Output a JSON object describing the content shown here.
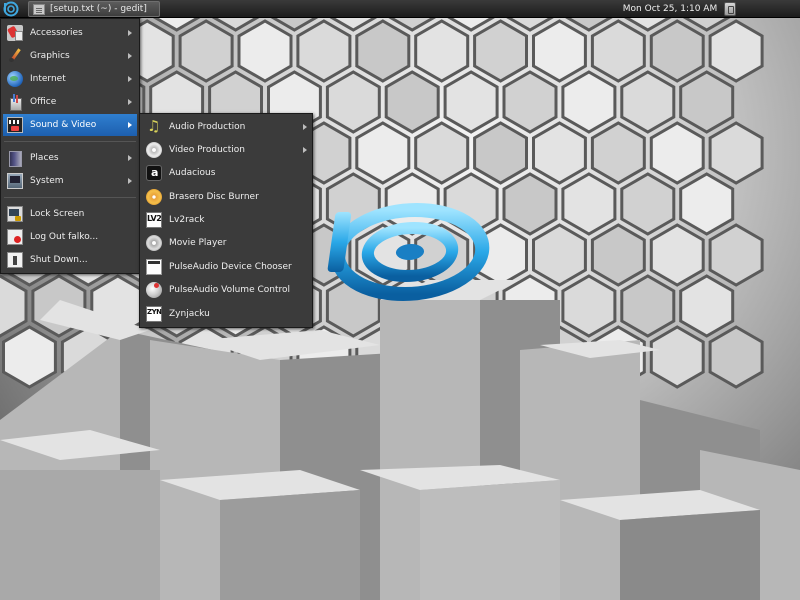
{
  "panel": {
    "menu_button_icon": "distro-logo-icon",
    "window_button": {
      "title": "[setup.txt (~) - gedit]",
      "icon": "text-editor-icon"
    },
    "clock": "Mon Oct 25,  1:10 AM",
    "tray_icon": "system-tray-icon"
  },
  "main_menu": {
    "items": [
      {
        "label": "Accessories",
        "icon": "accessories-icon",
        "has_submenu": true
      },
      {
        "label": "Graphics",
        "icon": "graphics-icon",
        "has_submenu": true
      },
      {
        "label": "Internet",
        "icon": "internet-globe-icon",
        "has_submenu": true
      },
      {
        "label": "Office",
        "icon": "office-icon",
        "has_submenu": true
      },
      {
        "label": "Sound & Video",
        "icon": "sound-video-icon",
        "has_submenu": true,
        "active": true
      },
      {
        "label": "Places",
        "icon": "places-icon",
        "has_submenu": true
      },
      {
        "label": "System",
        "icon": "system-icon",
        "has_submenu": true
      },
      {
        "label": "Lock Screen",
        "icon": "lock-screen-icon",
        "has_submenu": false
      },
      {
        "label": "Log Out falko...",
        "icon": "log-out-icon",
        "has_submenu": false
      },
      {
        "label": "Shut Down...",
        "icon": "shut-down-icon",
        "has_submenu": false
      }
    ]
  },
  "sound_video_menu": {
    "items": [
      {
        "label": "Audio Production",
        "icon": "music-note-icon",
        "has_submenu": true
      },
      {
        "label": "Video Production",
        "icon": "disc-icon",
        "has_submenu": true
      },
      {
        "label": "Audacious",
        "icon": "audacious-icon",
        "has_submenu": false
      },
      {
        "label": "Brasero Disc Burner",
        "icon": "brasero-icon",
        "has_submenu": false
      },
      {
        "label": "Lv2rack",
        "icon": "lv2rack-icon",
        "has_submenu": false
      },
      {
        "label": "Movie Player",
        "icon": "movie-player-icon",
        "has_submenu": false
      },
      {
        "label": "PulseAudio Device Chooser",
        "icon": "pulseaudio-chooser-icon",
        "has_submenu": false
      },
      {
        "label": "PulseAudio Volume Control",
        "icon": "pulseaudio-volume-icon",
        "has_submenu": false
      },
      {
        "label": "Zynjacku",
        "icon": "zynjacku-icon",
        "has_submenu": false
      }
    ]
  },
  "colors": {
    "menu_bg": "#3b3b3b",
    "menu_highlight": "#2f7fd0",
    "panel_bg": "#1c1c1c",
    "logo_blue": "#2aa8e8"
  }
}
